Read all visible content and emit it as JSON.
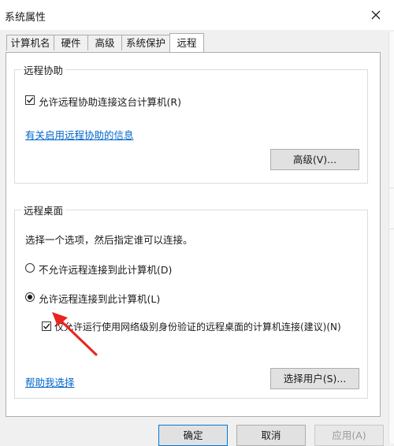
{
  "window": {
    "title": "系统属性"
  },
  "tabs": [
    {
      "label": "计算机名"
    },
    {
      "label": "硬件"
    },
    {
      "label": "高级"
    },
    {
      "label": "系统保护"
    },
    {
      "label": "远程"
    }
  ],
  "remote_assistance": {
    "group_label": "远程协助",
    "allow_label": "允许远程协助连接这台计算机(R)",
    "allow_checked": true,
    "info_link": "有关启用远程协助的信息",
    "advanced_button": "高级(V)..."
  },
  "remote_desktop": {
    "group_label": "远程桌面",
    "instruction": "选择一个选项，然后指定谁可以连接。",
    "option_deny": "不允许远程连接到此计算机(D)",
    "option_allow": "允许远程连接到此计算机(L)",
    "selected_option": "allow",
    "nla_label": "仅允许运行使用网络级别身份验证的远程桌面的计算机连接(建议)(N)",
    "nla_checked": true,
    "help_link": "帮助我选择",
    "select_users_button": "选择用户(S)..."
  },
  "footer": {
    "ok_button": "确定",
    "cancel_button": "取消",
    "apply_button": "应用(A)"
  },
  "colors": {
    "link": "#0066cc",
    "annotation_arrow": "#e8251f"
  }
}
